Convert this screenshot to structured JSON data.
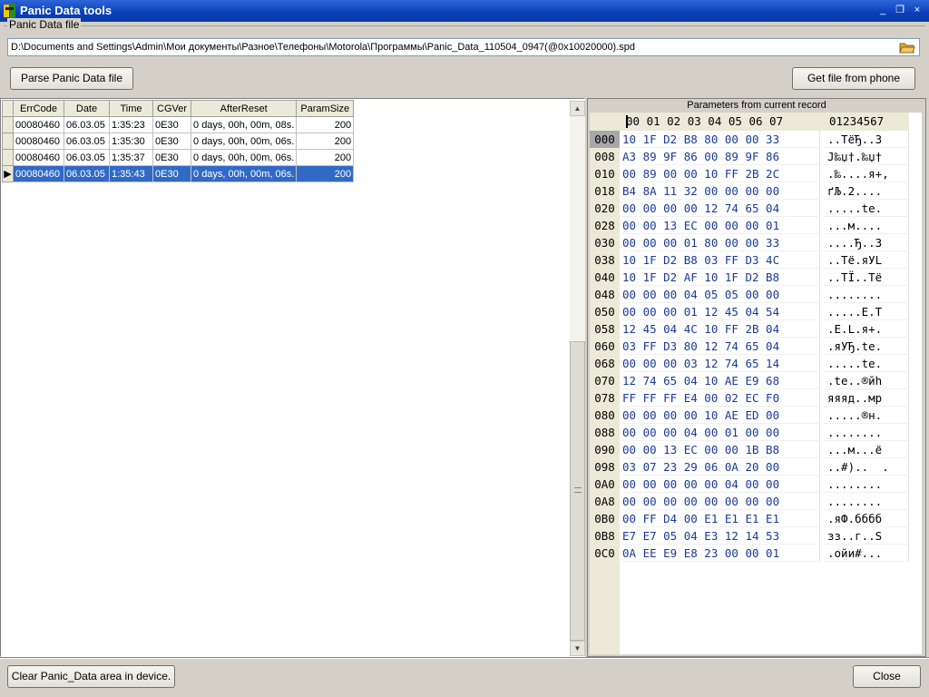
{
  "window": {
    "title": "Panic Data tools",
    "controls": [
      "_",
      "❐",
      "×"
    ]
  },
  "file_group": {
    "caption": "Panic Data file",
    "path": "D:\\Documents and Settings\\Admin\\Мои документы\\Разное\\Телефоны\\Motorola\\Программы\\Panic_Data_110504_0947(@0x10020000).spd"
  },
  "buttons": {
    "parse": "Parse Panic Data file",
    "get_file": "Get file from phone",
    "clear": "Clear Panic_Data area in device.",
    "close": "Close"
  },
  "grid": {
    "columns": [
      "ErrCode",
      "Date",
      "Time",
      "CGVer",
      "AfterReset",
      "ParamSize"
    ],
    "rows": [
      [
        "00080460",
        "06.03.05",
        "1:35:23",
        "0E30",
        "0 days, 00h, 00m, 08s.",
        "200"
      ],
      [
        "00080460",
        "06.03.05",
        "1:35:30",
        "0E30",
        "0 days, 00h, 00m, 06s.",
        "200"
      ],
      [
        "00080460",
        "06.03.05",
        "1:35:37",
        "0E30",
        "0 days, 00h, 00m, 06s.",
        "200"
      ],
      [
        "00080460",
        "06.03.05",
        "1:35:43",
        "0E30",
        "0 days, 00h, 00m, 06s.",
        "200"
      ]
    ],
    "selected_row": 3
  },
  "hex": {
    "caption": "Parameters from current record",
    "header_bytes": "00 01 02 03 04 05 06 07",
    "header_ascii": "01234567",
    "rows": [
      {
        "addr": "000",
        "bytes": "10 1F D2 B8 80 00 00 33",
        "ascii": "..TёЂ..3"
      },
      {
        "addr": "008",
        "bytes": "A3 89 9F 86 00 89 9F 86",
        "ascii": "Ј‰џ†.‰џ†"
      },
      {
        "addr": "010",
        "bytes": "00 89 00 00 10 FF 2B 2C",
        "ascii": ".‰....я+,"
      },
      {
        "addr": "018",
        "bytes": "B4 8A 11 32 00 00 00 00",
        "ascii": "ґЉ.2...."
      },
      {
        "addr": "020",
        "bytes": "00 00 00 00 12 74 65 04",
        "ascii": ".....te."
      },
      {
        "addr": "028",
        "bytes": "00 00 13 EC 00 00 00 01",
        "ascii": "...м...."
      },
      {
        "addr": "030",
        "bytes": "00 00 00 01 80 00 00 33",
        "ascii": "....Ђ..3"
      },
      {
        "addr": "038",
        "bytes": "10 1F D2 B8 03 FF D3 4C",
        "ascii": "..Tё.яУL"
      },
      {
        "addr": "040",
        "bytes": "10 1F D2 AF 10 1F D2 B8",
        "ascii": "..TЇ..Tё"
      },
      {
        "addr": "048",
        "bytes": "00 00 00 04 05 05 00 00",
        "ascii": "........"
      },
      {
        "addr": "050",
        "bytes": "00 00 00 01 12 45 04 54",
        "ascii": ".....E.T"
      },
      {
        "addr": "058",
        "bytes": "12 45 04 4C 10 FF 2B 04",
        "ascii": ".E.L.я+."
      },
      {
        "addr": "060",
        "bytes": "03 FF D3 80 12 74 65 04",
        "ascii": ".яУЂ.te."
      },
      {
        "addr": "068",
        "bytes": "00 00 00 03 12 74 65 14",
        "ascii": ".....te."
      },
      {
        "addr": "070",
        "bytes": "12 74 65 04 10 AE E9 68",
        "ascii": ".te..®йh"
      },
      {
        "addr": "078",
        "bytes": "FF FF FF E4 00 02 EC F0",
        "ascii": "яяяд..мр"
      },
      {
        "addr": "080",
        "bytes": "00 00 00 00 10 AE ED 00",
        "ascii": ".....®н."
      },
      {
        "addr": "088",
        "bytes": "00 00 00 04 00 01 00 00",
        "ascii": "........"
      },
      {
        "addr": "090",
        "bytes": "00 00 13 EC 00 00 1B B8",
        "ascii": "...м...ё"
      },
      {
        "addr": "098",
        "bytes": "03 07 23 29 06 0A 20 00",
        "ascii": "..#)..  ."
      },
      {
        "addr": "0A0",
        "bytes": "00 00 00 00 00 04 00 00",
        "ascii": "........"
      },
      {
        "addr": "0A8",
        "bytes": "00 00 00 00 00 00 00 00",
        "ascii": "........"
      },
      {
        "addr": "0B0",
        "bytes": "00 FF D4 00 E1 E1 E1 E1",
        "ascii": ".яФ.бббб"
      },
      {
        "addr": "0B8",
        "bytes": "E7 E7 05 04 E3 12 14 53",
        "ascii": "зз..г..S"
      },
      {
        "addr": "0C0",
        "bytes": "0A EE E9 E8 23 00 00 01",
        "ascii": ".ойи#..."
      }
    ]
  },
  "colors": {
    "title_bar": "#0a3fb8",
    "selection": "#316ac5",
    "hex_bytes": "#1a3a9a"
  }
}
